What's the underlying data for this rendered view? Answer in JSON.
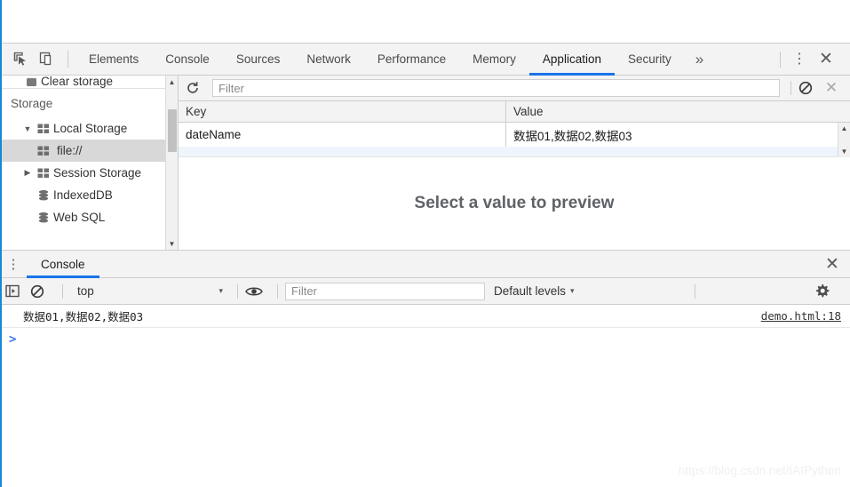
{
  "window": {
    "left_rule_color": "#1a87d6",
    "accent_color": "#1a73e8"
  },
  "devtools_tabs": {
    "inspect_icon": "inspect-element-icon",
    "device_icon": "device-toolbar-icon",
    "items": [
      {
        "label": "Elements",
        "active": false
      },
      {
        "label": "Console",
        "active": false
      },
      {
        "label": "Sources",
        "active": false
      },
      {
        "label": "Network",
        "active": false
      },
      {
        "label": "Performance",
        "active": false
      },
      {
        "label": "Memory",
        "active": false
      },
      {
        "label": "Application",
        "active": true
      },
      {
        "label": "Security",
        "active": false
      }
    ],
    "more_label": "»",
    "menu_label": "⋮",
    "close_label": "✕"
  },
  "sidebar": {
    "clipped_item": "Clear storage",
    "section_header": "Storage",
    "items": [
      {
        "label": "Local Storage",
        "twisty": "▼",
        "icon": "local-storage-icon",
        "indent": 1,
        "selected": false
      },
      {
        "label": "file://",
        "twisty": "",
        "icon": "local-storage-icon",
        "indent": 2,
        "selected": true
      },
      {
        "label": "Session Storage",
        "twisty": "▶",
        "icon": "session-storage-icon",
        "indent": 1,
        "selected": false
      },
      {
        "label": "IndexedDB",
        "twisty": "",
        "icon": "database-icon",
        "indent": 1,
        "selected": false
      },
      {
        "label": "Web SQL",
        "twisty": "",
        "icon": "database-icon",
        "indent": 1,
        "selected": false
      }
    ],
    "scroll_up": "▲",
    "scroll_down": "▼"
  },
  "storage_toolbar": {
    "refresh_icon": "refresh-icon",
    "filter_placeholder": "Filter",
    "filter_value": "",
    "clear_icon": "clear-all-icon",
    "delete_icon": "✕"
  },
  "storage_table": {
    "columns": [
      "Key",
      "Value"
    ],
    "rows": [
      {
        "key": "dateName",
        "value": "数据01,数据02,数据03"
      }
    ],
    "value_scroll_up": "▲",
    "value_scroll_down": "▼"
  },
  "preview": {
    "message": "Select a value to preview"
  },
  "drawer": {
    "menu_label": "⋮",
    "tab_label": "Console",
    "close_label": "✕"
  },
  "console_toolbar": {
    "sidebar_icon": "console-sidebar-icon",
    "clear_icon": "clear-console-icon",
    "context_value": "top",
    "context_caret": "▾",
    "eye_icon": "live-expression-icon",
    "filter_placeholder": "Filter",
    "filter_value": "",
    "levels_label": "Default levels",
    "levels_caret": "▾",
    "settings_icon": "gear-icon"
  },
  "console_body": {
    "messages": [
      {
        "text": "数据01,数据02,数据03",
        "source": "demo.html:18"
      }
    ],
    "prompt": ">"
  },
  "watermark": {
    "text": "https://blog.csdn.net/IAIPython"
  }
}
